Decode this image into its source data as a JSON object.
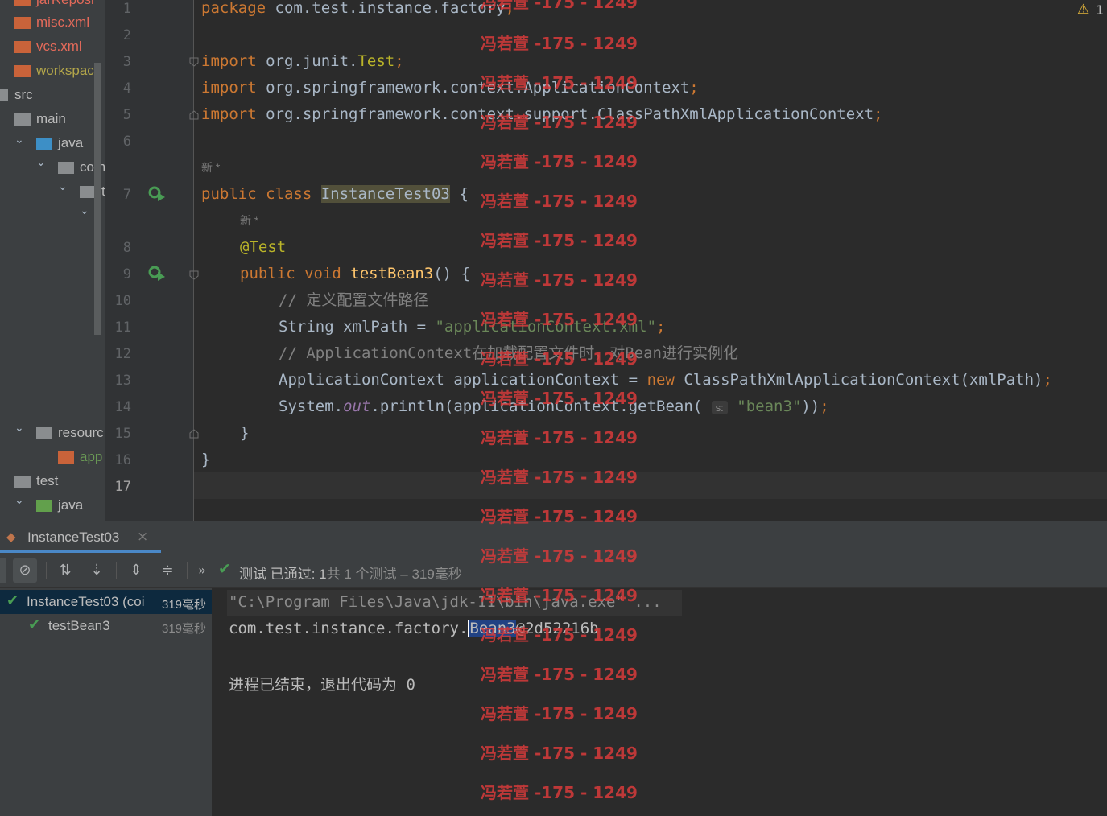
{
  "tree": {
    "items": [
      {
        "label": "jarReposi",
        "icon": "xml-file-icon"
      },
      {
        "label": "misc.xml",
        "icon": "xml-file-icon"
      },
      {
        "label": "vcs.xml",
        "icon": "xml-file-icon"
      },
      {
        "label": "workspac",
        "icon": "xml-file-icon"
      },
      {
        "label": "src",
        "icon": "folder-icon"
      },
      {
        "label": "main",
        "icon": "folder-icon"
      },
      {
        "label": "java",
        "icon": "source-folder-icon"
      },
      {
        "label": "com",
        "icon": "package-icon"
      },
      {
        "label": "t",
        "icon": "package-icon"
      },
      {
        "label": "resourc",
        "icon": "resources-folder-icon"
      },
      {
        "label": "app",
        "icon": "xml-file-icon"
      },
      {
        "label": "test",
        "icon": "folder-icon"
      },
      {
        "label": "java",
        "icon": "test-source-folder-icon"
      }
    ]
  },
  "editor": {
    "line_numbers": [
      "1",
      "2",
      "3",
      "4",
      "5",
      "6",
      "7",
      "8",
      "9",
      "10",
      "11",
      "12",
      "13",
      "14",
      "15",
      "16",
      "17"
    ],
    "warnings_count": "1",
    "usage_hint_1": "新 *",
    "usage_hint_2": "新 *",
    "inlay_hint": "s:",
    "code": {
      "l1_kw": "package",
      "l1_rest": " com.test.instance.factory",
      "l3_kw": "import",
      "l3_pkg": " org.junit.",
      "l3_cls": "Test",
      "l4_kw": "import",
      "l4_rest": " org.springframework.context.ApplicationContext",
      "l5_kw": "import",
      "l5_rest": " org.springframework.context.support.ClassPathXmlApplicationContext",
      "semi": ";",
      "l7_kw": "public class ",
      "l7_cls": "InstanceTest03",
      "l7_rest": " {",
      "l8_ann": "@Test",
      "l9_kw": "public void ",
      "l9_fn": "testBean3",
      "l9_rest": "() {",
      "l10_cmt": "// 定义配置文件路径",
      "l11_a": "String xmlPath = ",
      "l11_str": "\"applicationContext.xml\"",
      "l12_cmt": "// ApplicationContext在加载配置文件时，对Bean进行实例化",
      "l13_a": "ApplicationContext applicationContext = ",
      "l13_kw": "new",
      "l13_b": " ClassPathXmlApplicationContext(xmlPath)",
      "l14_a": "System.",
      "l14_fld": "out",
      "l14_b": ".println(applicationContext.getBean(",
      "l14_str": "\"bean3\"",
      "l14_c": "))",
      "l15": "}",
      "l16": "}"
    }
  },
  "run": {
    "tab_label": "InstanceTest03",
    "status_prefix": "测试 已通过: ",
    "status_count": "1",
    "status_rest": "共 1 个测试 – 319毫秒",
    "tests": [
      {
        "name": "InstanceTest03 (coi",
        "time": "319毫秒"
      },
      {
        "name": "testBean3",
        "time": "319毫秒"
      }
    ],
    "console": {
      "line1": "\"C:\\Program Files\\Java\\jdk-11\\bin\\java.exe\" ...",
      "line2_a": "com.test.instance.factory.",
      "line2_sel": "Bean3",
      "line2_b": "@2d52216b",
      "line3": "进程已结束，退出代码为 0"
    }
  },
  "watermark": "冯若萱 -175 - 1249",
  "colors": {
    "keyword": "#cc7832",
    "string": "#6a8759",
    "annotation": "#bbb529",
    "function": "#ffc66d",
    "watermark": "#d83b3b",
    "pass": "#499c54"
  }
}
